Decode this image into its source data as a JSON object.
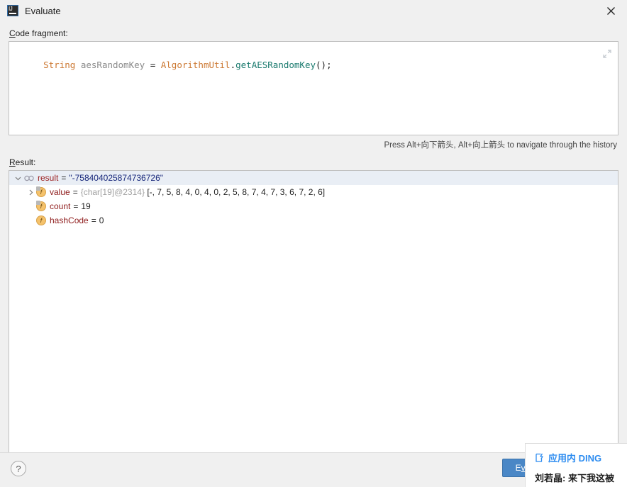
{
  "window": {
    "title": "Evaluate",
    "app_icon": "intellij-idea-icon",
    "close_icon": "close-icon"
  },
  "code_fragment": {
    "label": "Code fragment:",
    "label_mnemonic": "C",
    "expand_icon": "expand-editor-icon",
    "tokens": [
      {
        "text": "String",
        "kind": "keyword"
      },
      {
        "text": " ",
        "kind": "plain"
      },
      {
        "text": "aesRandomKey",
        "kind": "variable"
      },
      {
        "text": " ",
        "kind": "plain"
      },
      {
        "text": "=",
        "kind": "operator"
      },
      {
        "text": " ",
        "kind": "plain"
      },
      {
        "text": "AlgorithmUtil",
        "kind": "class"
      },
      {
        "text": ".",
        "kind": "punct"
      },
      {
        "text": "getAESRandomKey",
        "kind": "method"
      },
      {
        "text": "()",
        "kind": "punct"
      },
      {
        "text": ";",
        "kind": "punct"
      }
    ],
    "plain_text": "String aesRandomKey = AlgorithmUtil.getAESRandomKey();",
    "hint": "Press Alt+向下箭头, Alt+向上箭头 to navigate through the history"
  },
  "result": {
    "label": "Result:",
    "label_mnemonic": "R",
    "rows": [
      {
        "depth": 0,
        "expanded": true,
        "twisty": "chevron-down-icon",
        "icon": "object-value-icon",
        "icon_glyph": "oo",
        "name": "result",
        "eq": "=",
        "value": "\"-758404025874736726\"",
        "value_kind": "string",
        "selected": true
      },
      {
        "depth": 1,
        "expanded": false,
        "twisty": "chevron-right-icon",
        "icon": "field-icon",
        "icon_glyph": "f",
        "name": "value",
        "eq": "=",
        "value_ref": "{char[19]@2314}",
        "value": "[-, 7, 5, 8, 4, 0, 4, 0, 2, 5, 8, 7, 4, 7, 3, 6, 7, 2, 6]",
        "value_kind": "array",
        "selected": false
      },
      {
        "depth": 1,
        "expanded": false,
        "twisty": "none",
        "icon": "field-icon",
        "icon_glyph": "f",
        "name": "count",
        "eq": "=",
        "value": "19",
        "value_kind": "number",
        "selected": false
      },
      {
        "depth": 1,
        "expanded": false,
        "twisty": "none",
        "icon": "field-icon",
        "icon_glyph": "f",
        "name": "hashCode",
        "eq": "=",
        "value": "0",
        "value_kind": "number",
        "selected": false
      }
    ]
  },
  "footer": {
    "help_label": "?",
    "help_icon": "help-icon",
    "evaluate_label_before": "E",
    "evaluate_mnemonic": "v",
    "evaluate_label_after": "aluate",
    "evaluate_full_label": "Evaluate"
  },
  "notification": {
    "icon": "ding-app-icon",
    "title": "应用内 DING",
    "message": "刘若晶: 来下我这被"
  },
  "colors": {
    "dialog_bg": "#f0f0f0",
    "panel_bg": "#ffffff",
    "panel_border": "#c0c0c0",
    "accent_button": "#4a87c6",
    "keyword": "#cc7832",
    "method": "#1a7a6e",
    "variable": "#8a8a8a",
    "tree_name": "#9b1f1f",
    "string_value": "#16267a",
    "selection": "#e9eef5",
    "ding_blue": "#2d8cf0"
  }
}
